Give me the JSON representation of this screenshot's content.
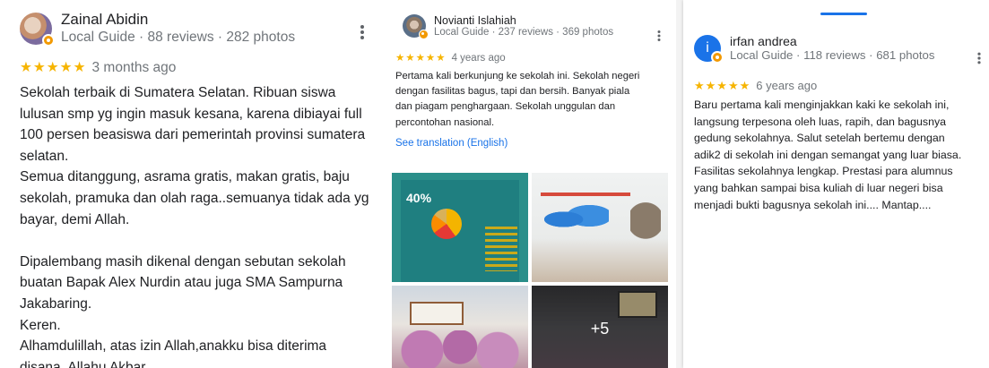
{
  "reviews": [
    {
      "reviewer": "Zainal Abidin",
      "meta": "Local Guide · 88 reviews · 282 photos",
      "stars": "★★★★★",
      "time": "3 months ago",
      "text": "Sekolah terbaik di Sumatera Selatan. Ribuan siswa\nlulusan smp yg ingin masuk kesana, karena dibiayai full\n100 persen beasiswa dari pemerintah provinsi sumatera\nselatan.\nSemua ditanggung, asrama gratis, makan gratis, baju\nsekolah, pramuka dan olah raga..semuanya tidak ada yg\nbayar, demi Allah.\n\nDipalembang masih dikenal dengan sebutan sekolah\nbuatan Bapak Alex Nurdin atau juga SMA Sampurna\nJakabaring.\nKeren.\nAlhamdulillah, atas izin Allah,anakku bisa diterima\ndisana. Allahu Akbar."
    },
    {
      "reviewer": "Novianti Islahiah",
      "meta": "Local Guide · 237 reviews · 369 photos",
      "stars": "★★★★★",
      "time": "4 years ago",
      "text": "Pertama kali berkunjung ke sekolah ini. Sekolah negeri\ndengan fasilitas bagus, tapi dan bersih. Banyak piala\ndan piagam penghargaan. Sekolah unggulan dan\npercontohan nasional.",
      "translate_link": "See translation (English)",
      "photo_chart_label": "40%",
      "more_photos": "+5"
    },
    {
      "reviewer": "irfan andrea",
      "avatar_letter": "i",
      "meta": "Local Guide · 118 reviews · 681 photos",
      "stars": "★★★★★",
      "time": "6 years ago",
      "text": "Baru pertama kali menginjakkan kaki ke sekolah ini,\nlangsung terpesona oleh luas, rapih, dan bagusnya\ngedung sekolahnya. Salut setelah bertemu dengan\nadik2 di sekolah ini dengan semangat yang luar biasa.\nFasilitas sekolahnya lengkap.  Prestasi para alumnus\nyang bahkan sampai bisa kuliah di luar negeri bisa\nmenjadi bukti bagusnya sekolah ini.... Mantap...."
    }
  ],
  "colors": {
    "star": "#f6b400",
    "link": "#1a73e8",
    "badge": "#f29900",
    "secondary_text": "#70757a"
  },
  "icons": [
    "kebab-menu-icon",
    "local-guide-badge-icon"
  ]
}
